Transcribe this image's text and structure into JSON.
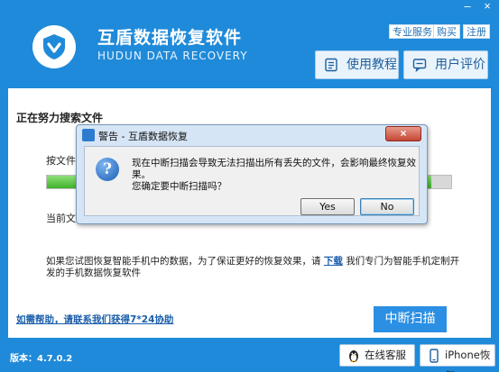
{
  "window": {
    "title_cn": "互盾数据恢复软件",
    "title_en": "HUDUN DATA RECOVERY",
    "minimize_symbol": "–",
    "close_symbol": "×"
  },
  "top_links": {
    "service": "专业服务",
    "buy": "购买",
    "register": "注册"
  },
  "header_buttons": {
    "tutorial": "使用教程",
    "review": "用户评价"
  },
  "scan": {
    "heading": "正在努力搜索文件",
    "by_file": "按文件",
    "progress": 0.95,
    "current_dir": "当前文",
    "mobile_note_before": "如果您试图恢复智能手机中的数据，为了保证更好的恢复效果，请",
    "mobile_note_link": "下载",
    "mobile_note_after": "我们专门为智能手机定制开发的手机数据恢复软件",
    "help": "如需帮助，请联系我们获得7*24协助",
    "stop_button": "中断扫描"
  },
  "footer": {
    "version": "版本：4.7.0.2",
    "online_service": "在线客服",
    "iphone_recovery": "iPhone恢复"
  },
  "dialog": {
    "title": "警告 - 互盾数据恢复",
    "close_symbol": "×",
    "icon_glyph": "?",
    "message_line1": "现在中断扫描会导致无法扫描出所有丢失的文件，会影响最终恢复效果。",
    "message_line2": "您确定要中断扫描吗？",
    "yes": "Yes",
    "no": "No"
  },
  "colors": {
    "brand_blue": "#1f8ad9",
    "progress_green": "#3fb12a",
    "link_blue": "#1b5eaa",
    "dialog_frame": "#d6e5f5"
  }
}
